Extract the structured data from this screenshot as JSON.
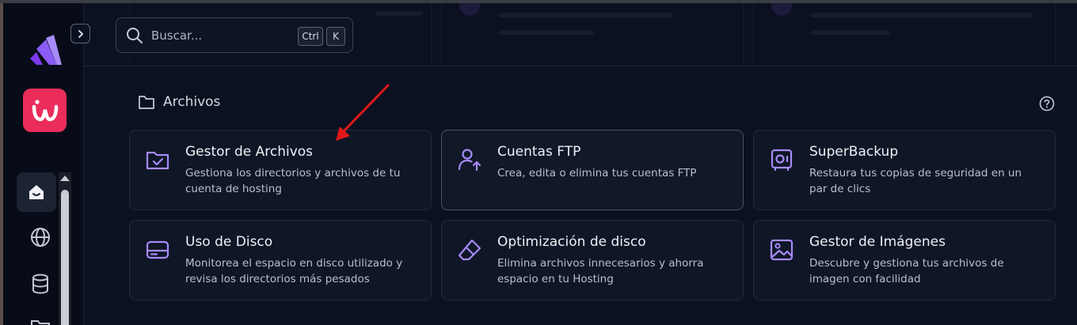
{
  "search": {
    "placeholder": "Buscar...",
    "shortcut_keys": [
      "Ctrl",
      "K"
    ]
  },
  "section": {
    "title": "Archivos"
  },
  "cards": [
    {
      "title": "Gestor de Archivos",
      "description": "Gestiona los directorios y archivos de tu cuenta de hosting",
      "icon": "folder-check-icon"
    },
    {
      "title": "Cuentas FTP",
      "description": "Crea, edita o elimina tus cuentas FTP",
      "icon": "user-upload-icon"
    },
    {
      "title": "SuperBackup",
      "description": "Restaura tus copias de seguridad en un par de clics",
      "icon": "safe-icon"
    },
    {
      "title": "Uso de Disco",
      "description": "Monitorea el espacio en disco utilizado y revisa los directorios más pesados",
      "icon": "hard-drive-icon"
    },
    {
      "title": "Optimización de disco",
      "description": "Elimina archivos innecesarios y ahorra espacio en tu Hosting",
      "icon": "eraser-icon"
    },
    {
      "title": "Gestor de Imágenes",
      "description": "Descubre y gestiona tus archivos de imagen con facilidad",
      "icon": "image-icon"
    }
  ],
  "sidebar": {
    "items": [
      "home-icon",
      "globe-icon",
      "database-icon",
      "folder-icon"
    ]
  },
  "colors": {
    "accent": "#a78bfa",
    "brand": "#ea2d5b",
    "background": "#0b1120",
    "card": "#0f1626",
    "annotation_arrow": "#e01818"
  }
}
